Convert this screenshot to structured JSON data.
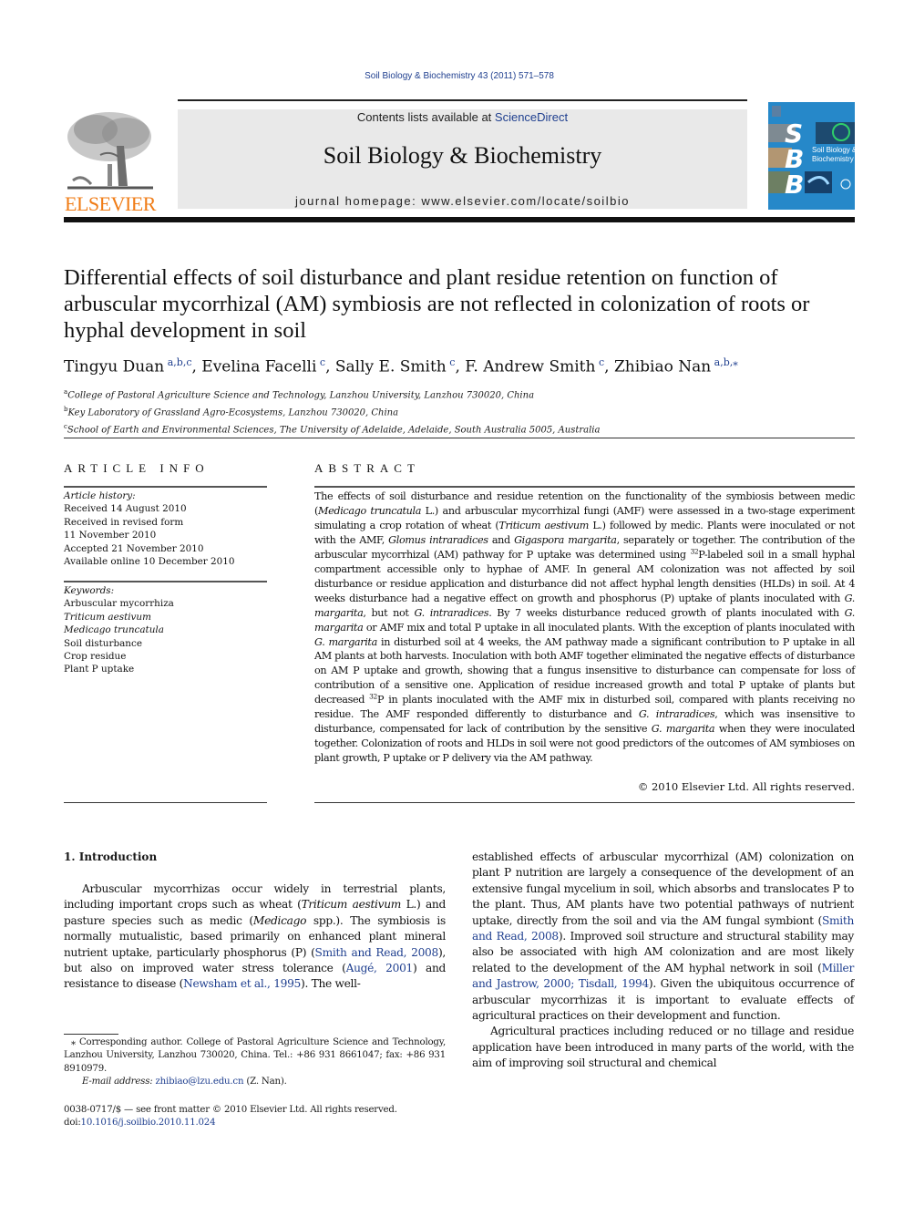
{
  "running_head": "Soil Biology & Biochemistry 43 (2011) 571–578",
  "header": {
    "publisher_wordmark": "ELSEVIER",
    "contents_prefix": "Contents lists available at ",
    "contents_link": "ScienceDirect",
    "journal_name": "Soil Biology & Biochemistry",
    "homepage_label": "journal homepage: ",
    "homepage_url": "www.elsevier.com/locate/soilbio",
    "cover": {
      "letters": [
        "S",
        "B",
        "B"
      ],
      "title_line1": "Soil Biology &",
      "title_line2": "Biochemistry",
      "background_color": "#2688c9"
    },
    "brand_color": "#f07c16",
    "link_color": "#1f3f8f"
  },
  "article": {
    "title": "Differential effects of soil disturbance and plant residue retention on function of arbuscular mycorrhizal (AM) symbiosis are not reflected in colonization of roots or hyphal development in soil",
    "authors": [
      {
        "name": "Tingyu Duan",
        "affil": "a,b,c"
      },
      {
        "name": "Evelina Facelli",
        "affil": "c"
      },
      {
        "name": "Sally E. Smith",
        "affil": "c"
      },
      {
        "name": "F. Andrew Smith",
        "affil": "c"
      },
      {
        "name": "Zhibiao Nan",
        "affil": "a,b,⁎"
      }
    ],
    "affiliations": [
      {
        "mark": "a",
        "text": "College of Pastoral Agriculture Science and Technology, Lanzhou University, Lanzhou 730020, China"
      },
      {
        "mark": "b",
        "text": "Key Laboratory of Grassland Agro-Ecosystems, Lanzhou 730020, China"
      },
      {
        "mark": "c",
        "text": "School of Earth and Environmental Sciences, The University of Adelaide, Adelaide, South Australia 5005, Australia"
      }
    ]
  },
  "article_info": {
    "heading": "ARTICLE INFO",
    "history_label": "Article history:",
    "history": [
      "Received 14 August 2010",
      "Received in revised form",
      "11 November 2010",
      "Accepted 21 November 2010",
      "Available online 10 December 2010"
    ],
    "keywords_label": "Keywords:",
    "keywords": [
      {
        "text": "Arbuscular mycorrhiza",
        "italic": false
      },
      {
        "text": "Triticum aestivum",
        "italic": true
      },
      {
        "text": "Medicago truncatula",
        "italic": true
      },
      {
        "text": "Soil disturbance",
        "italic": false
      },
      {
        "text": "Crop residue",
        "italic": false
      },
      {
        "text": "Plant P uptake",
        "italic": false
      }
    ]
  },
  "abstract": {
    "heading": "ABSTRACT",
    "segments": [
      {
        "t": "The effects of soil disturbance and residue retention on the functionality of the symbiosis between medic ("
      },
      {
        "t": "Medicago truncatula",
        "i": true
      },
      {
        "t": " L.) and arbuscular mycorrhizal fungi (AMF) were assessed in a two-stage experiment simulating a crop rotation of wheat ("
      },
      {
        "t": "Triticum aestivum",
        "i": true
      },
      {
        "t": " L.) followed by medic. Plants were inoculated or not with the AMF, "
      },
      {
        "t": "Glomus intraradices",
        "i": true
      },
      {
        "t": " and "
      },
      {
        "t": "Gigaspora margarita",
        "i": true
      },
      {
        "t": ", separately or together. The contribution of the arbuscular mycorrhizal (AM) pathway for P uptake was determined using "
      },
      {
        "t": "32",
        "sup": true
      },
      {
        "t": "P-labeled soil in a small hyphal compartment accessible only to hyphae of AMF. In general AM colonization was not affected by soil disturbance or residue application and disturbance did not affect hyphal length densities (HLDs) in soil. At 4 weeks disturbance had a negative effect on growth and phosphorus (P) uptake of plants inoculated with "
      },
      {
        "t": "G. margarita",
        "i": true
      },
      {
        "t": ", but not "
      },
      {
        "t": "G. intraradices",
        "i": true
      },
      {
        "t": ". By 7 weeks disturbance reduced growth of plants inoculated with "
      },
      {
        "t": "G. margarita",
        "i": true
      },
      {
        "t": " or AMF mix and total P uptake in all inoculated plants. With the exception of plants inoculated with "
      },
      {
        "t": "G. margarita",
        "i": true
      },
      {
        "t": " in disturbed soil at 4 weeks, the AM pathway made a significant contribution to P uptake in all AM plants at both harvests. Inoculation with both AMF together eliminated the negative effects of disturbance on AM P uptake and growth, showing that a fungus insensitive to disturbance can compensate for loss of contribution of a sensitive one. Application of residue increased growth and total P uptake of plants but decreased "
      },
      {
        "t": "32",
        "sup": true
      },
      {
        "t": "P in plants inoculated with the AMF mix in disturbed soil, compared with plants receiving no residue. The AMF responded differently to disturbance and "
      },
      {
        "t": "G. intraradices",
        "i": true
      },
      {
        "t": ", which was insensitive to disturbance, compensated for lack of contribution by the sensitive "
      },
      {
        "t": "G. margarita",
        "i": true
      },
      {
        "t": " when they were inoculated together. Colonization of roots and HLDs in soil were not good predictors of the outcomes of AM symbioses on plant growth, P uptake or P delivery via the AM pathway."
      }
    ],
    "copyright": "© 2010 Elsevier Ltd. All rights reserved."
  },
  "introduction": {
    "heading": "1.  Introduction",
    "left_paragraph": [
      {
        "t": "Arbuscular mycorrhizas occur widely in terrestrial plants, including important crops such as wheat ("
      },
      {
        "t": "Triticum aestivum",
        "i": true
      },
      {
        "t": " L.) and pasture species such as medic ("
      },
      {
        "t": "Medicago",
        "i": true
      },
      {
        "t": " spp.). The symbiosis is normally mutualistic, based primarily on enhanced plant mineral nutrient uptake, particularly phosphorus (P) ("
      },
      {
        "t": "Smith and Read, 2008",
        "link": true
      },
      {
        "t": "), but also on improved water stress tolerance ("
      },
      {
        "t": "Augé, 2001",
        "link": true
      },
      {
        "t": ") and resistance to disease ("
      },
      {
        "t": "Newsham et al., 1995",
        "link": true
      },
      {
        "t": "). The well-"
      }
    ],
    "right_paragraph_1": [
      {
        "t": "established effects of arbuscular mycorrhizal (AM) colonization on plant P nutrition are largely a consequence of the development of an extensive fungal mycelium in soil, which absorbs and translocates P to the plant. Thus, AM plants have two potential pathways of nutrient uptake, directly from the soil and via the AM fungal symbiont ("
      },
      {
        "t": "Smith and Read, 2008",
        "link": true
      },
      {
        "t": "). Improved soil structure and structural stability may also be associated with high AM colonization and are most likely related to the development of the AM hyphal network in soil ("
      },
      {
        "t": "Miller and Jastrow, 2000; Tisdall, 1994",
        "link": true
      },
      {
        "t": "). Given the ubiquitous occurrence of arbuscular mycorrhizas it is important to evaluate effects of agricultural practices on their development and function."
      }
    ],
    "right_paragraph_2": [
      {
        "t": "Agricultural practices including reduced or no tillage and residue application have been introduced in many parts of the world, with the aim of improving soil structural and chemical"
      }
    ]
  },
  "footnote": {
    "mark": "⁎",
    "text": " Corresponding author. College of Pastoral Agriculture Science and Technology, Lanzhou University, Lanzhou 730020, China. Tel.: +86 931 8661047; fax: +86 931 8910979.",
    "email_label": "E-mail address: ",
    "email": "zhibiao@lzu.edu.cn",
    "email_suffix": " (Z. Nan)."
  },
  "front_matter": {
    "issn_line": "0038-0717/$ — see front matter © 2010 Elsevier Ltd. All rights reserved.",
    "doi_label": "doi:",
    "doi": "10.1016/j.soilbio.2010.11.024"
  }
}
